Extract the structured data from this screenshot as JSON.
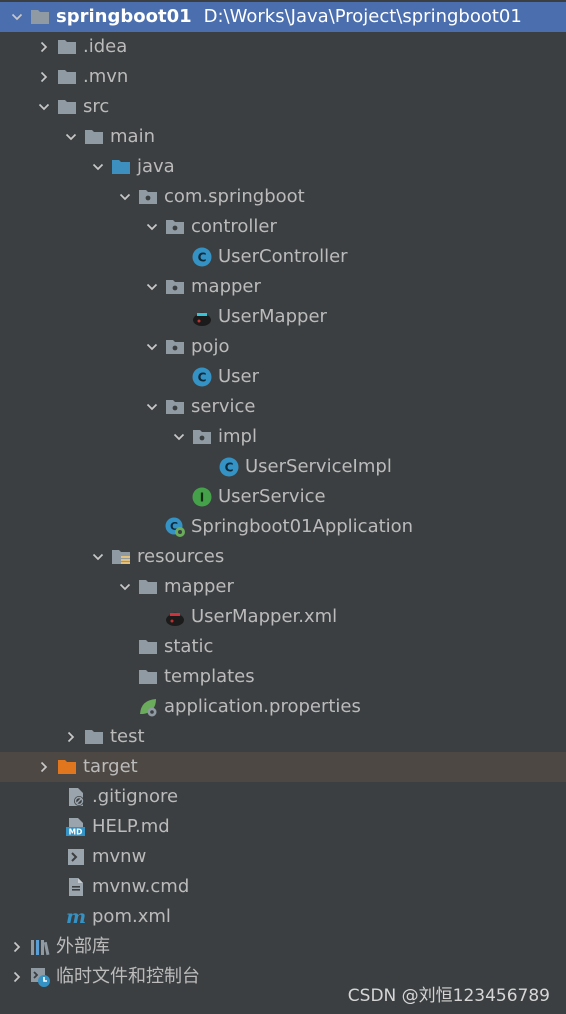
{
  "project": {
    "name": "springboot01",
    "path": "D:\\Works\\Java\\Project\\springboot01"
  },
  "tree": {
    "idea": ".idea",
    "mvn": ".mvn",
    "src": "src",
    "main": "main",
    "java": "java",
    "pkg": "com.springboot",
    "controller": "controller",
    "user_controller": "UserController",
    "mapper_pkg": "mapper",
    "user_mapper": "UserMapper",
    "pojo": "pojo",
    "user": "User",
    "service": "service",
    "impl": "impl",
    "user_service_impl": "UserServiceImpl",
    "user_service": "UserService",
    "app": "Springboot01Application",
    "resources": "resources",
    "res_mapper": "mapper",
    "user_mapper_xml": "UserMapper.xml",
    "static": "static",
    "templates": "templates",
    "app_props": "application.properties",
    "test": "test",
    "target": "target",
    "gitignore": ".gitignore",
    "help": "HELP.md",
    "mvnw": "mvnw",
    "mvnw_cmd": "mvnw.cmd",
    "pom": "pom.xml",
    "ext_libs": "外部库",
    "scratches": "临时文件和控制台"
  },
  "colors": {
    "selection": "#4b6eaf",
    "excluded_bg": "#4d4843",
    "folder": "#8f9aa3",
    "source_folder": "#3d8fbf",
    "target_folder": "#e0771e",
    "class_icon": "#3592c4",
    "interface_icon": "#45a24a"
  },
  "watermark": "CSDN @刘恒123456789"
}
